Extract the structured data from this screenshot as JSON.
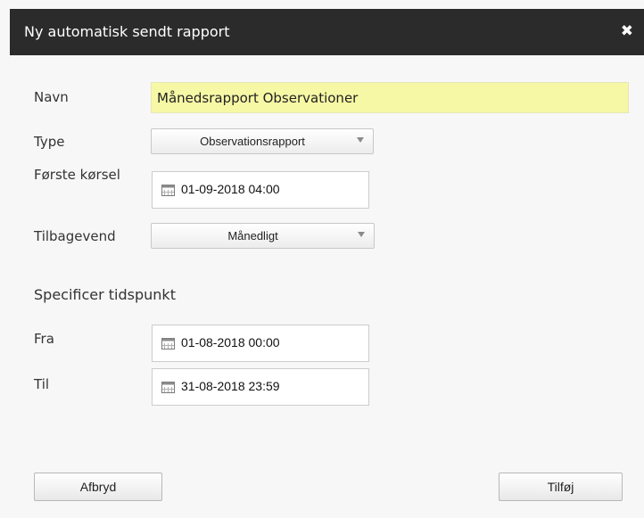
{
  "dialog": {
    "title": "Ny automatisk sendt rapport",
    "close_symbol": "✖"
  },
  "form": {
    "name_label": "Navn",
    "name_value": "Månedsrapport Observationer",
    "type_label": "Type",
    "type_value": "Observationsrapport",
    "first_run_label": "Første kørsel",
    "first_run_value": "01-09-2018 04:00",
    "recurrence_label": "Tilbagevend",
    "recurrence_value": "Månedligt",
    "specify_time_heading": "Specificer tidspunkt",
    "from_label": "Fra",
    "from_value": "01-08-2018 00:00",
    "to_label": "Til",
    "to_value": "31-08-2018 23:59"
  },
  "buttons": {
    "cancel_label": "Afbryd",
    "add_label": "Tilføj"
  },
  "icons": {
    "close": "close-icon",
    "calendar": "calendar-icon",
    "dropdown": "chevron-down-icon"
  },
  "colors": {
    "titlebar": "#2b2b2b",
    "name_field_highlight": "#f6f8a5",
    "background": "#f7f7f7"
  }
}
